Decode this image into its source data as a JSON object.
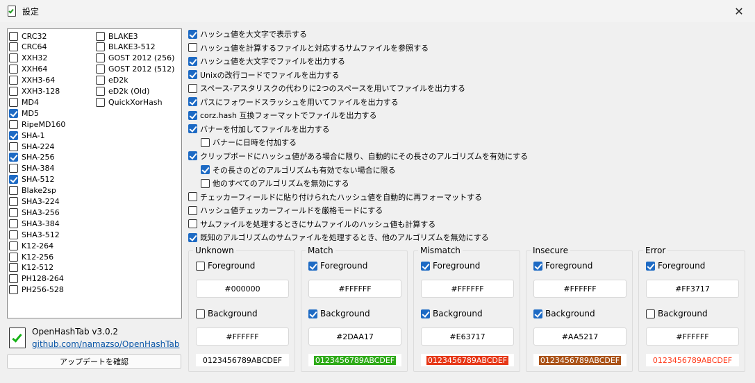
{
  "window": {
    "title": "設定",
    "close_glyph": "✕"
  },
  "hash_algorithms": [
    {
      "label": "CRC32",
      "checked": false
    },
    {
      "label": "CRC64",
      "checked": false
    },
    {
      "label": "XXH32",
      "checked": false
    },
    {
      "label": "XXH64",
      "checked": false
    },
    {
      "label": "XXH3-64",
      "checked": false
    },
    {
      "label": "XXH3-128",
      "checked": false
    },
    {
      "label": "MD4",
      "checked": false
    },
    {
      "label": "MD5",
      "checked": true
    },
    {
      "label": "RipeMD160",
      "checked": false
    },
    {
      "label": "SHA-1",
      "checked": true
    },
    {
      "label": "SHA-224",
      "checked": false
    },
    {
      "label": "SHA-256",
      "checked": true
    },
    {
      "label": "SHA-384",
      "checked": false
    },
    {
      "label": "SHA-512",
      "checked": true
    },
    {
      "label": "Blake2sp",
      "checked": false
    },
    {
      "label": "SHA3-224",
      "checked": false
    },
    {
      "label": "SHA3-256",
      "checked": false
    },
    {
      "label": "SHA3-384",
      "checked": false
    },
    {
      "label": "SHA3-512",
      "checked": false
    },
    {
      "label": "K12-264",
      "checked": false
    },
    {
      "label": "K12-256",
      "checked": false
    },
    {
      "label": "K12-512",
      "checked": false
    },
    {
      "label": "PH128-264",
      "checked": false
    },
    {
      "label": "PH256-528",
      "checked": false
    },
    {
      "label": "BLAKE3",
      "checked": false
    },
    {
      "label": "BLAKE3-512",
      "checked": false
    },
    {
      "label": "GOST 2012 (256)",
      "checked": false
    },
    {
      "label": "GOST 2012 (512)",
      "checked": false
    },
    {
      "label": "eD2k",
      "checked": false
    },
    {
      "label": "eD2k (Old)",
      "checked": false
    },
    {
      "label": "QuickXorHash",
      "checked": false
    }
  ],
  "about": {
    "name": "OpenHashTab v3.0.2",
    "link": "github.com/namazso/OpenHashTab",
    "update_button": "アップデートを確認"
  },
  "options": [
    {
      "label": "ハッシュ値を大文字で表示する",
      "checked": true,
      "indent": 0
    },
    {
      "label": "ハッシュ値を計算するファイルと対応するサムファイルを参照する",
      "checked": false,
      "indent": 0
    },
    {
      "label": "ハッシュ値を大文字でファイルを出力する",
      "checked": true,
      "indent": 0
    },
    {
      "label": "Unixの改行コードでファイルを出力する",
      "checked": true,
      "indent": 0
    },
    {
      "label": "スペース-アスタリスクの代わりに2つのスペースを用いてファイルを出力する",
      "checked": false,
      "indent": 0
    },
    {
      "label": "パスにフォワードスラッシュを用いてファイルを出力する",
      "checked": true,
      "indent": 0
    },
    {
      "label": "corz.hash 互換フォーマットでファイルを出力する",
      "checked": true,
      "indent": 0
    },
    {
      "label": "バナーを付加してファイルを出力する",
      "checked": true,
      "indent": 0
    },
    {
      "label": "バナーに日時を付加する",
      "checked": false,
      "indent": 1
    },
    {
      "label": "クリップボードにハッシュ値がある場合に限り、自動的にその長さのアルゴリズムを有効にする",
      "checked": true,
      "indent": 0
    },
    {
      "label": "その長さのどのアルゴリズムも有効でない場合に限る",
      "checked": true,
      "indent": 1
    },
    {
      "label": "他のすべてのアルゴリズムを無効にする",
      "checked": false,
      "indent": 1
    },
    {
      "label": "チェッカーフィールドに貼り付けられたハッシュ値を自動的に再フォーマットする",
      "checked": false,
      "indent": 0
    },
    {
      "label": "ハッシュ値チェッカーフィールドを厳格モードにする",
      "checked": false,
      "indent": 0
    },
    {
      "label": "サムファイルを処理するときにサムファイルのハッシュ値も計算する",
      "checked": false,
      "indent": 0
    },
    {
      "label": "既知のアルゴリズムのサムファイルを処理するとき、他のアルゴリズムを無効にする",
      "checked": true,
      "indent": 0
    }
  ],
  "color_groups": [
    {
      "title": "Unknown",
      "foreground_label": "Foreground",
      "foreground_checked": false,
      "foreground": "#000000",
      "background_label": "Background",
      "background_checked": false,
      "background": "#FFFFFF",
      "sample": "0123456789ABCDEF",
      "sample_fg": "#000000",
      "sample_bg": "#FFFFFF"
    },
    {
      "title": "Match",
      "foreground_label": "Foreground",
      "foreground_checked": true,
      "foreground": "#FFFFFF",
      "background_label": "Background",
      "background_checked": true,
      "background": "#2DAA17",
      "sample": "0123456789ABCDEF",
      "sample_fg": "#FFFFFF",
      "sample_bg": "#2DAA17"
    },
    {
      "title": "Mismatch",
      "foreground_label": "Foreground",
      "foreground_checked": true,
      "foreground": "#FFFFFF",
      "background_label": "Background",
      "background_checked": true,
      "background": "#E63717",
      "sample": "0123456789ABCDEF",
      "sample_fg": "#FFFFFF",
      "sample_bg": "#E63717"
    },
    {
      "title": "Insecure",
      "foreground_label": "Foreground",
      "foreground_checked": true,
      "foreground": "#FFFFFF",
      "background_label": "Background",
      "background_checked": true,
      "background": "#AA5217",
      "sample": "0123456789ABCDEF",
      "sample_fg": "#FFFFFF",
      "sample_bg": "#AA5217"
    },
    {
      "title": "Error",
      "foreground_label": "Foreground",
      "foreground_checked": true,
      "foreground": "#FF3717",
      "background_label": "Background",
      "background_checked": false,
      "background": "#FFFFFF",
      "sample": "0123456789ABCDEF",
      "sample_fg": "#FF3717",
      "sample_bg": "#FFFFFF"
    }
  ]
}
